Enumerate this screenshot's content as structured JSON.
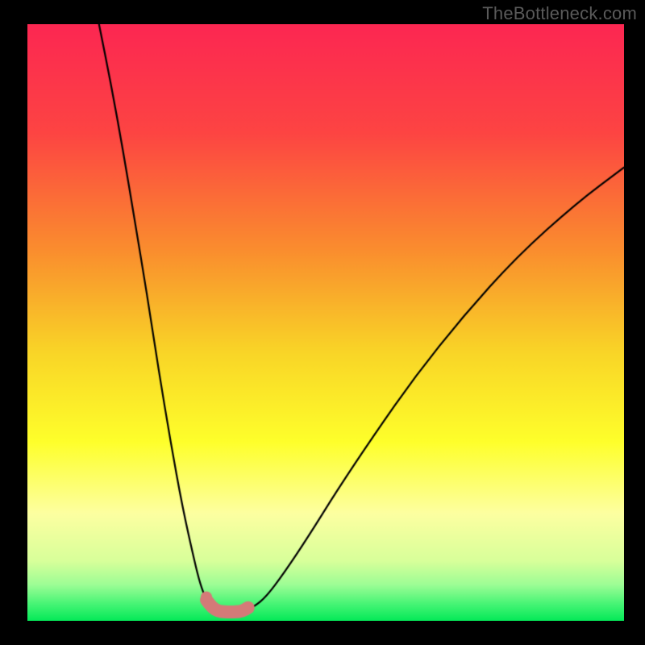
{
  "watermark": "TheBottleneck.com",
  "chart_data": {
    "type": "line",
    "title": "",
    "xlabel": "",
    "ylabel": "",
    "xlim": [
      0,
      100
    ],
    "ylim": [
      0,
      100
    ],
    "legend": false,
    "grid": false,
    "series": [
      {
        "name": "curve-left",
        "style": "line",
        "color": "#000000",
        "x": [
          12,
          14,
          16,
          18,
          20,
          22,
          24,
          26,
          28,
          29,
          30,
          31,
          32
        ],
        "values": [
          100,
          90,
          79,
          67,
          55,
          42,
          30,
          19,
          10,
          6,
          3.5,
          2.4,
          2
        ]
      },
      {
        "name": "curve-right",
        "style": "line",
        "color": "#000000",
        "x": [
          37,
          38,
          40,
          43,
          47,
          52,
          58,
          65,
          73,
          82,
          92,
          100
        ],
        "values": [
          2,
          2.4,
          4,
          8,
          14,
          22,
          31,
          41,
          51,
          61,
          70,
          76
        ]
      },
      {
        "name": "flat-minimum-band",
        "style": "thick-line",
        "color": "#d47a78",
        "x": [
          30,
          31,
          32,
          33,
          34,
          35,
          36,
          37
        ],
        "values": [
          3.5,
          2.2,
          1.6,
          1.5,
          1.5,
          1.5,
          1.6,
          2.2
        ]
      },
      {
        "name": "minimum-marker",
        "style": "point",
        "color": "#d47a78",
        "x": [
          30
        ],
        "values": [
          4
        ]
      }
    ],
    "background_gradient": {
      "stops": [
        {
          "pos": 0.0,
          "color": "#fc2752"
        },
        {
          "pos": 0.18,
          "color": "#fd4443"
        },
        {
          "pos": 0.38,
          "color": "#fa8e2e"
        },
        {
          "pos": 0.55,
          "color": "#f9d527"
        },
        {
          "pos": 0.7,
          "color": "#feff2b"
        },
        {
          "pos": 0.82,
          "color": "#fdffa1"
        },
        {
          "pos": 0.9,
          "color": "#d8ff9a"
        },
        {
          "pos": 0.94,
          "color": "#9cfd95"
        },
        {
          "pos": 0.97,
          "color": "#4bf577"
        },
        {
          "pos": 1.0,
          "color": "#05e958"
        }
      ]
    }
  }
}
